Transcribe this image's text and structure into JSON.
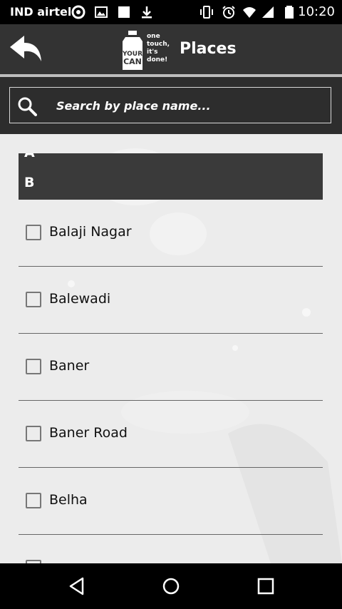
{
  "status_bar": {
    "carrier": "IND airtel",
    "time": "10:20"
  },
  "app_bar": {
    "title": "Places",
    "logo": {
      "brand": "YOUR CAN",
      "tagline": [
        "one",
        "touch,",
        "it's",
        "done!"
      ]
    }
  },
  "search": {
    "placeholder": "Search by place name..."
  },
  "sections": [
    {
      "letter": "A"
    },
    {
      "letter": "B"
    }
  ],
  "places": [
    {
      "label": "Balaji Nagar",
      "checked": false
    },
    {
      "label": "Balewadi",
      "checked": false
    },
    {
      "label": "Baner",
      "checked": false
    },
    {
      "label": "Baner Road",
      "checked": false
    },
    {
      "label": "Belha",
      "checked": false
    },
    {
      "label": "",
      "checked": false
    }
  ],
  "colors": {
    "app_bar": "#333333",
    "search_bar": "#2d2d2d",
    "section_header": "#3a3a3a",
    "text": "#111111"
  }
}
